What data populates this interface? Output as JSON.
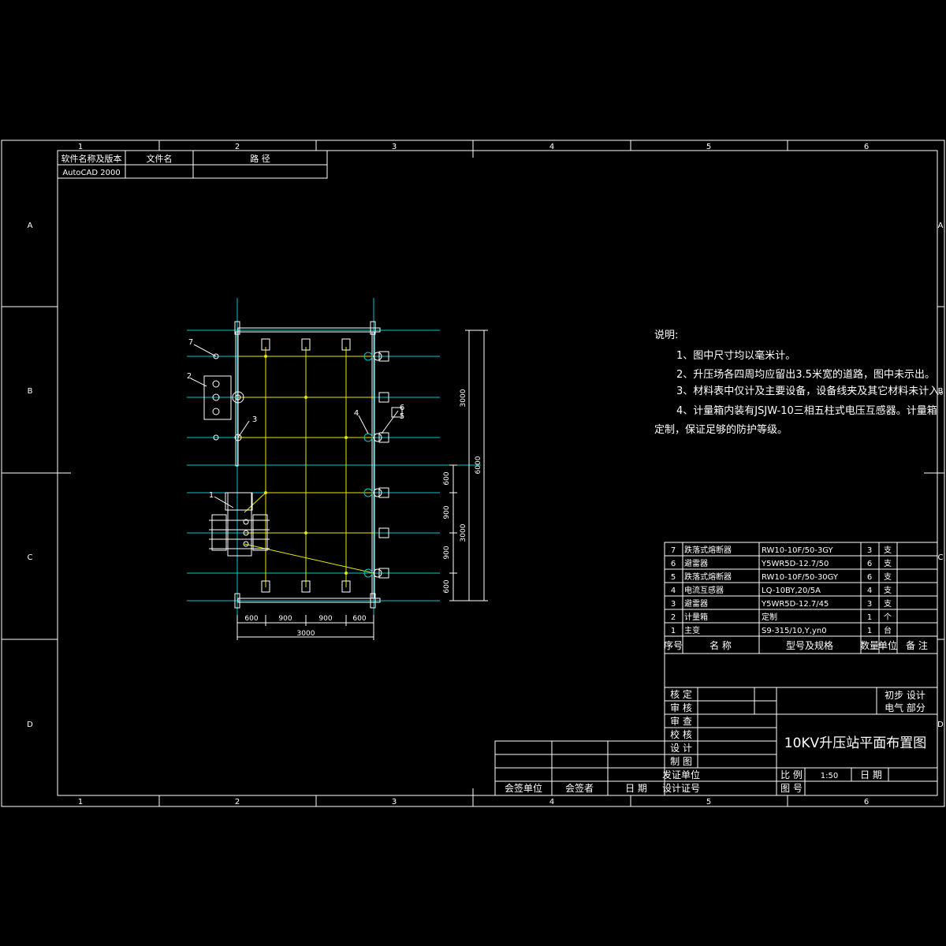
{
  "frame": {
    "columns": [
      "1",
      "2",
      "3",
      "4",
      "5",
      "6"
    ],
    "rows": [
      "A",
      "B",
      "C",
      "D"
    ]
  },
  "software_box": {
    "headers": [
      "软件名称及版本",
      "文件名",
      "路 径"
    ],
    "values": [
      "AutoCAD 2000",
      "",
      ""
    ]
  },
  "notes": {
    "heading": "说明:",
    "lines": [
      "1、图中尺寸均以毫米计。",
      "2、升压场各四周均应留出3.5米宽的道路，图中未示出。",
      "3、材料表中仅计及主要设备，设备线夹及其它材料未计入。",
      "4、计量箱内装有JSJW-10三相五柱式电压互感器。计量箱",
      "定制，保证足够的防护等级。"
    ]
  },
  "bom": {
    "header": {
      "seq": "序号",
      "name": "名 称",
      "model": "型号及规格",
      "qty": "数量",
      "unit": "单位",
      "remark": "备 注"
    },
    "rows": [
      {
        "seq": "7",
        "name": "跌落式熔断器",
        "model": "RW10-10F/50-3GY",
        "qty": "3",
        "unit": "支"
      },
      {
        "seq": "6",
        "name": "避雷器",
        "model": "Y5WR5D-12.7/50",
        "qty": "6",
        "unit": "支"
      },
      {
        "seq": "5",
        "name": "跌落式熔断器",
        "model": "RW10-10F/50-30GY",
        "qty": "6",
        "unit": "支"
      },
      {
        "seq": "4",
        "name": "电流互感器",
        "model": "LQ-10BY,20/5A",
        "qty": "4",
        "unit": "支"
      },
      {
        "seq": "3",
        "name": "避雷器",
        "model": "Y5WR5D-12.7/45",
        "qty": "3",
        "unit": "支"
      },
      {
        "seq": "2",
        "name": "计量箱",
        "model": "定制",
        "qty": "1",
        "unit": "个"
      },
      {
        "seq": "1",
        "name": "主变",
        "model": "S9-315/10,Y,yn0",
        "qty": "1",
        "unit": "台"
      }
    ]
  },
  "title_block": {
    "roles": [
      "核 定",
      "审 核",
      "审 查",
      "校 核",
      "设 计",
      "制 图"
    ],
    "stage": "初步 设计",
    "discipline": "电气 部分",
    "drawing_title": "10KV升压站平面布置图",
    "scale_label": "比 例",
    "scale_value": "1:50",
    "date_label": "日 期",
    "drawing_no_label": "图 号",
    "issuer_label": "发证单位",
    "cert_label": "设计证号",
    "countersign": [
      "会签单位",
      "会签者",
      "日 期"
    ]
  },
  "plan": {
    "dims_bottom": [
      "600",
      "900",
      "900",
      "600"
    ],
    "dim_total": "3000",
    "dims_right_segments": [
      "600",
      "900",
      "900",
      "600"
    ],
    "dim_right_upper": "3000",
    "dim_right_lower": "3000",
    "dim_right_total": "6000",
    "callouts": [
      "7",
      "2",
      "3",
      "1",
      "4",
      "6",
      "5"
    ]
  }
}
